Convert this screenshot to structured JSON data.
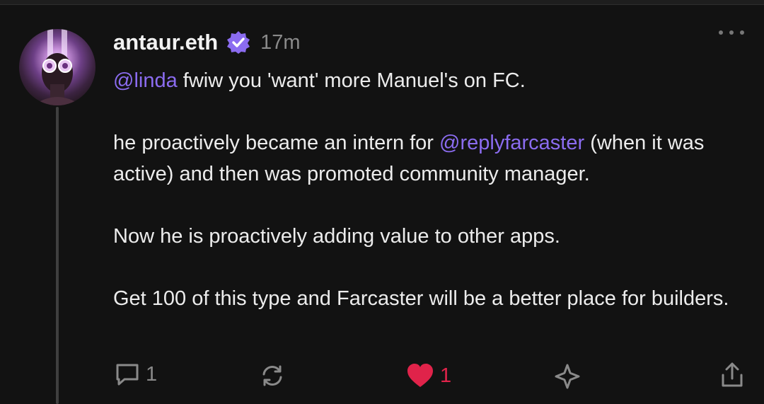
{
  "post": {
    "author": {
      "username": "antaur.eth",
      "verified": true,
      "time_ago": "17m"
    },
    "paragraphs": [
      [
        {
          "text": "@linda",
          "mention": true
        },
        {
          "text": " fwiw you 'want' more Manuel's on FC.",
          "mention": false
        }
      ],
      [
        {
          "text": "he proactively became an intern for ",
          "mention": false
        },
        {
          "text": "@replyfarcaster",
          "mention": true
        },
        {
          "text": " (when it was active) and then was promoted community manager.",
          "mention": false
        }
      ],
      [
        {
          "text": "Now he is proactively adding value to other apps.",
          "mention": false
        }
      ],
      [
        {
          "text": "Get 100 of this type and Farcaster will be a better place for builders.",
          "mention": false
        }
      ]
    ]
  },
  "actions": {
    "reply_count": "1",
    "like_count": "1",
    "liked": true,
    "icons": [
      "comment-icon",
      "recast-icon",
      "heart-icon",
      "star-icon",
      "share-icon"
    ]
  },
  "colors": {
    "background": "#121212",
    "mention": "#8b6cf0",
    "verified_badge": "#8b6cf0",
    "like": "#e0234a",
    "muted": "#8a8a8a"
  }
}
